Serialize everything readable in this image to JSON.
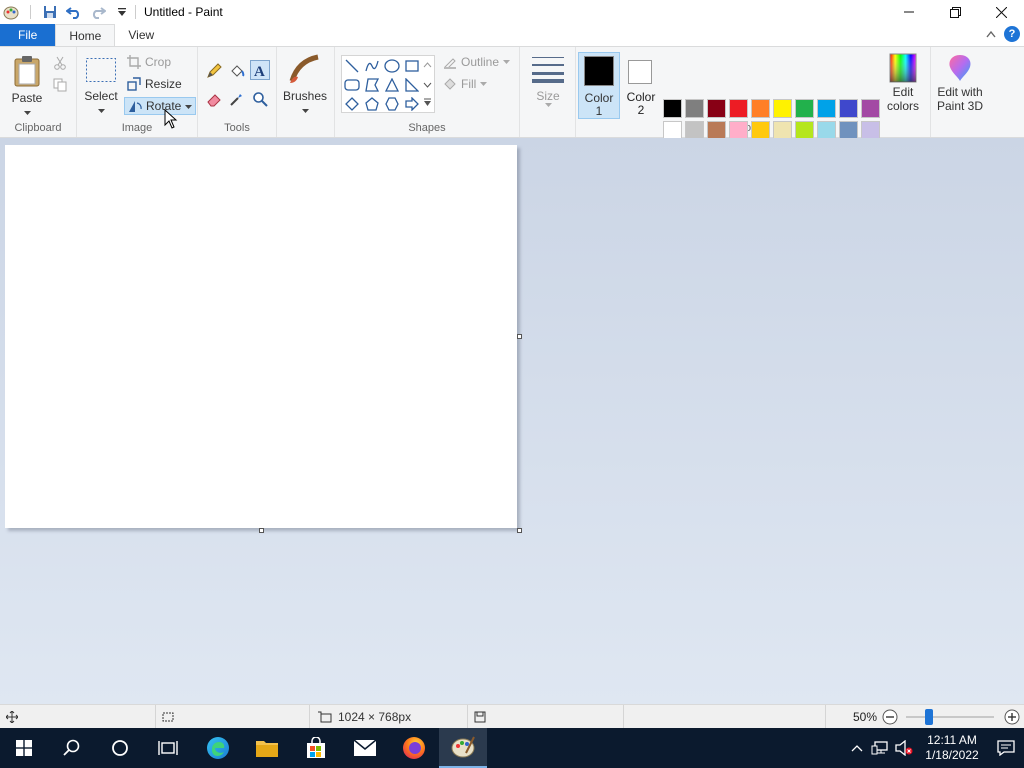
{
  "window": {
    "title": "Untitled - Paint"
  },
  "tabs": {
    "file": "File",
    "home": "Home",
    "view": "View"
  },
  "ribbon": {
    "clipboard": {
      "group_label": "Clipboard",
      "paste": "Paste"
    },
    "image": {
      "group_label": "Image",
      "select": "Select",
      "crop": "Crop",
      "resize": "Resize",
      "rotate": "Rotate"
    },
    "tools": {
      "group_label": "Tools"
    },
    "brushes": {
      "label": "Brushes"
    },
    "shapes": {
      "group_label": "Shapes",
      "outline": "Outline",
      "fill": "Fill"
    },
    "size": {
      "label": "Size"
    },
    "colors": {
      "group_label": "Colors",
      "color1_label": "Color",
      "color1_num": "1",
      "color2_label": "Color",
      "color2_num": "2",
      "edit_colors_1": "Edit",
      "edit_colors_2": "colors",
      "paint3d_1": "Edit with",
      "paint3d_2": "Paint 3D",
      "color1_value": "#000000",
      "color2_value": "#ffffff",
      "palette_row1": [
        "#000000",
        "#7f7f7f",
        "#880015",
        "#ed1c24",
        "#ff7f27",
        "#fff200",
        "#22b14c",
        "#00a2e8",
        "#3f48cc",
        "#a349a4"
      ],
      "palette_row2": [
        "#ffffff",
        "#c3c3c3",
        "#b97a57",
        "#ffaec9",
        "#ffc90e",
        "#efe4b0",
        "#b5e61d",
        "#99d9ea",
        "#7092be",
        "#c8bfe7"
      ],
      "palette_row3": [
        "#ffffff",
        "#ffffff",
        "#ffffff",
        "#ffffff",
        "#ffffff",
        "#ffffff",
        "#ffffff",
        "#ffffff",
        "#ffffff",
        "#ffffff"
      ]
    }
  },
  "status": {
    "dimensions": "1024 × 768px",
    "zoom": "50%"
  },
  "taskbar": {
    "time": "12:11 AM",
    "date": "1/18/2022"
  }
}
